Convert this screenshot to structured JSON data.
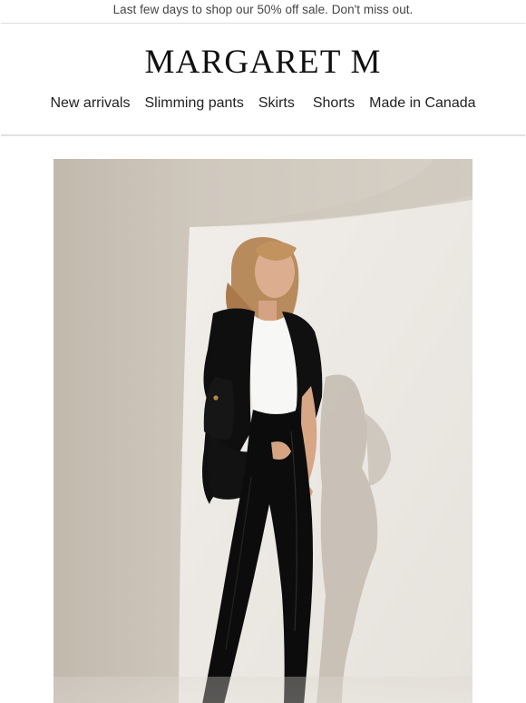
{
  "announcement": {
    "text": "Last few days to shop our 50% off sale. Don't miss out."
  },
  "brand": {
    "logo_text": "MARGARET M"
  },
  "nav": {
    "items": [
      {
        "label": "New arrivals"
      },
      {
        "label": "Slimming pants"
      },
      {
        "label": "Skirts"
      },
      {
        "label": "Shorts"
      },
      {
        "label": "Made in Canada"
      }
    ]
  },
  "hero": {
    "icon": "product-photo",
    "colors": {
      "wall_light": "#ece9e4",
      "wall_shadow": "#c6beb2",
      "suit": "#0d0d0d",
      "top": "#f7f7f5",
      "skin": "#d9a988",
      "hair": "#b98a5c"
    }
  }
}
